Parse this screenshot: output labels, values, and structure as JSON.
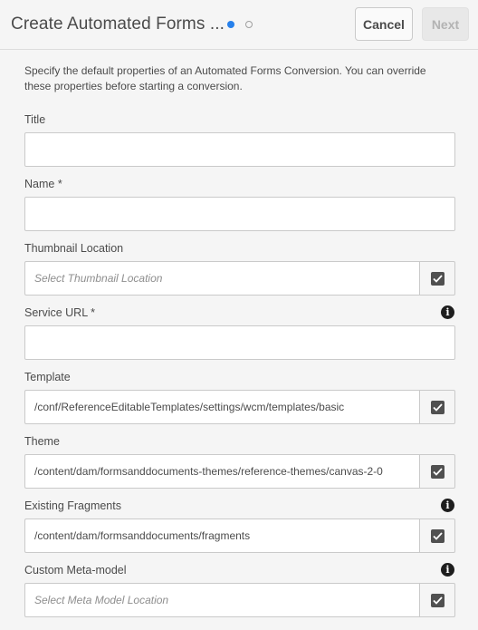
{
  "header": {
    "title": "Create Automated Forms ...",
    "steps": [
      "step-1",
      "step-2"
    ],
    "cancel_label": "Cancel",
    "next_label": "Next"
  },
  "description": "Specify the default properties of an Automated Forms Conversion. You can override these properties before starting a conversion.",
  "fields": {
    "title": {
      "label": "Title",
      "value": ""
    },
    "name": {
      "label": "Name *",
      "value": ""
    },
    "thumbnail": {
      "label": "Thumbnail Location",
      "placeholder": "Select Thumbnail Location"
    },
    "service_url": {
      "label": "Service URL *",
      "value": ""
    },
    "template": {
      "label": "Template",
      "value": "/conf/ReferenceEditableTemplates/settings/wcm/templates/basic"
    },
    "theme": {
      "label": "Theme",
      "value": "/content/dam/formsanddocuments-themes/reference-themes/canvas-2-0"
    },
    "fragments": {
      "label": "Existing Fragments",
      "value": "/content/dam/formsanddocuments/fragments"
    },
    "meta_model": {
      "label": "Custom Meta-model",
      "placeholder": "Select Meta Model Location"
    }
  },
  "icons": {
    "info": "info-icon",
    "picker": "check-box-icon"
  },
  "colors": {
    "accent": "#2680eb",
    "background": "#f5f5f5"
  }
}
